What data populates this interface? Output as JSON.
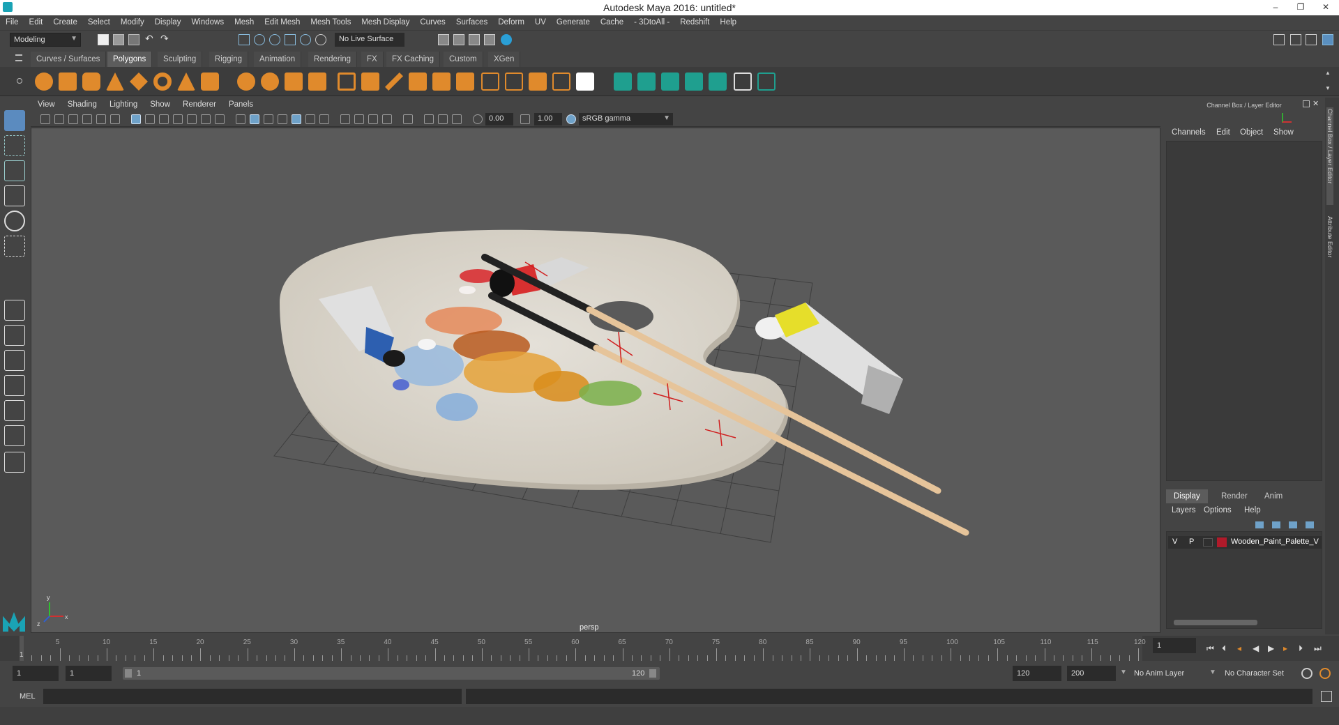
{
  "app": {
    "title": "Autodesk Maya 2016: untitled*"
  },
  "window_controls": {
    "minimize": "–",
    "restore": "❐",
    "close": "✕"
  },
  "menubar": [
    "File",
    "Edit",
    "Create",
    "Select",
    "Modify",
    "Display",
    "Windows",
    "Mesh",
    "Edit Mesh",
    "Mesh Tools",
    "Mesh Display",
    "Curves",
    "Surfaces",
    "Deform",
    "UV",
    "Generate",
    "Cache",
    "- 3DtoAll -",
    "Redshift",
    "Help"
  ],
  "status": {
    "mode": "Modeling",
    "live_surface": "No Live Surface"
  },
  "shelf_tabs": [
    "Curves / Surfaces",
    "Polygons",
    "Sculpting",
    "Rigging",
    "Animation",
    "Rendering",
    "FX",
    "FX Caching",
    "Custom",
    "XGen"
  ],
  "shelf_active_tab": "Polygons",
  "viewport": {
    "menu": [
      "View",
      "Shading",
      "Lighting",
      "Show",
      "Renderer",
      "Panels"
    ],
    "exposure": "0.00",
    "gamma": "1.00",
    "color_space": "sRGB gamma",
    "camera": "persp",
    "axis_labels": {
      "x": "x",
      "y": "y",
      "z": "z"
    }
  },
  "right_panel": {
    "title": "Channel Box / Layer Editor",
    "channel_menu": [
      "Channels",
      "Edit",
      "Object",
      "Show"
    ],
    "display_tabs": [
      "Display",
      "Render",
      "Anim"
    ],
    "active_display_tab": "Display",
    "layer_menu": [
      "Layers",
      "Options",
      "Help"
    ],
    "layer": {
      "visible": "V",
      "playback": "P",
      "name": "Wooden_Paint_Palette_V",
      "color": "#b01a2a"
    }
  },
  "side_tabs": {
    "channel_box": "Channel Box / Layer Editor",
    "attribute_editor": "Attribute Editor"
  },
  "timeline": {
    "labels": [
      "5",
      "10",
      "15",
      "20",
      "25",
      "30",
      "35",
      "40",
      "45",
      "50",
      "55",
      "60",
      "65",
      "70",
      "75",
      "80",
      "85",
      "90",
      "95",
      "100",
      "105",
      "110",
      "115",
      "120"
    ],
    "current_frame_label": "1",
    "current_frame": "1"
  },
  "range": {
    "start": "1",
    "playback_start": "1",
    "slider_start": "1",
    "slider_end": "120",
    "playback_end": "120",
    "end": "200",
    "anim_layer": "No Anim Layer",
    "character_set": "No Character Set"
  },
  "command": {
    "label": "MEL"
  }
}
